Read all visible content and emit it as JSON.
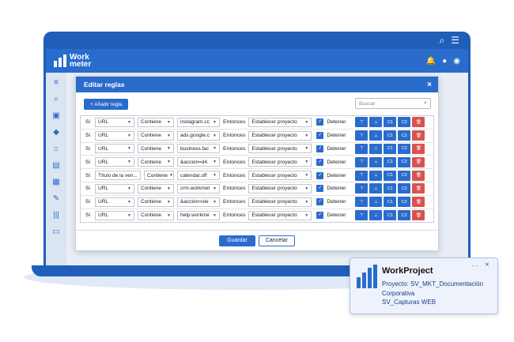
{
  "topbar": {
    "search_icon": "search-icon",
    "menu_icon": "menu-icon"
  },
  "app": {
    "logo_line1": "Work",
    "logo_line2": "meter"
  },
  "modal": {
    "title": "Editar reglas",
    "close": "×",
    "add_label": "+ Añadir regla",
    "search_placeholder": "Buscar",
    "save_label": "Guardar",
    "cancel_label": "Cancelar",
    "rules": [
      {
        "si": "Si",
        "field": "URL",
        "op": "Contiene",
        "value": "instagram.cc",
        "then": "Entonces",
        "action": "Establecer proyecto",
        "stop": "Detener"
      },
      {
        "si": "Si",
        "field": "URL",
        "op": "Contiene",
        "value": "ads.google.c",
        "then": "Entonces",
        "action": "Establecer proyecto",
        "stop": "Detener"
      },
      {
        "si": "Si",
        "field": "URL",
        "op": "Contiene",
        "value": "business.fac",
        "then": "Entonces",
        "action": "Establecer proyecto",
        "stop": "Detener"
      },
      {
        "si": "Si",
        "field": "URL",
        "op": "Contiene",
        "value": "&accion=d4",
        "then": "Entonces",
        "action": "Establecer proyecto",
        "stop": "Detener"
      },
      {
        "si": "Si",
        "field": "Título de la ven...",
        "op": "Contiene",
        "value": "calendar.off",
        "then": "Entonces",
        "action": "Establecer proyecto",
        "stop": "Detener"
      },
      {
        "si": "Si",
        "field": "URL",
        "op": "Contiene",
        "value": "crm.workmet",
        "then": "Entonces",
        "action": "Establecer proyecto",
        "stop": "Detener"
      },
      {
        "si": "Si",
        "field": "URL",
        "op": "Contiene",
        "value": "&accion=ole",
        "then": "Entonces",
        "action": "Establecer proyecto",
        "stop": "Detener"
      },
      {
        "si": "Si",
        "field": "URL",
        "op": "Contiene",
        "value": "help.workme",
        "then": "Entonces",
        "action": "Establecer proyecto",
        "stop": "Detener"
      }
    ],
    "row_buttons": [
      "⊤",
      "⊥",
      "C1",
      "C2",
      "🗑"
    ]
  },
  "card": {
    "title": "WorkProject",
    "line1": "Proyecto: SV_MKT_Documentación Corporativa",
    "line2": "SV_Capturas WEB",
    "dots": "···",
    "close": "×"
  },
  "colors": {
    "brand": "#2a6ccc",
    "danger": "#d9534f"
  }
}
